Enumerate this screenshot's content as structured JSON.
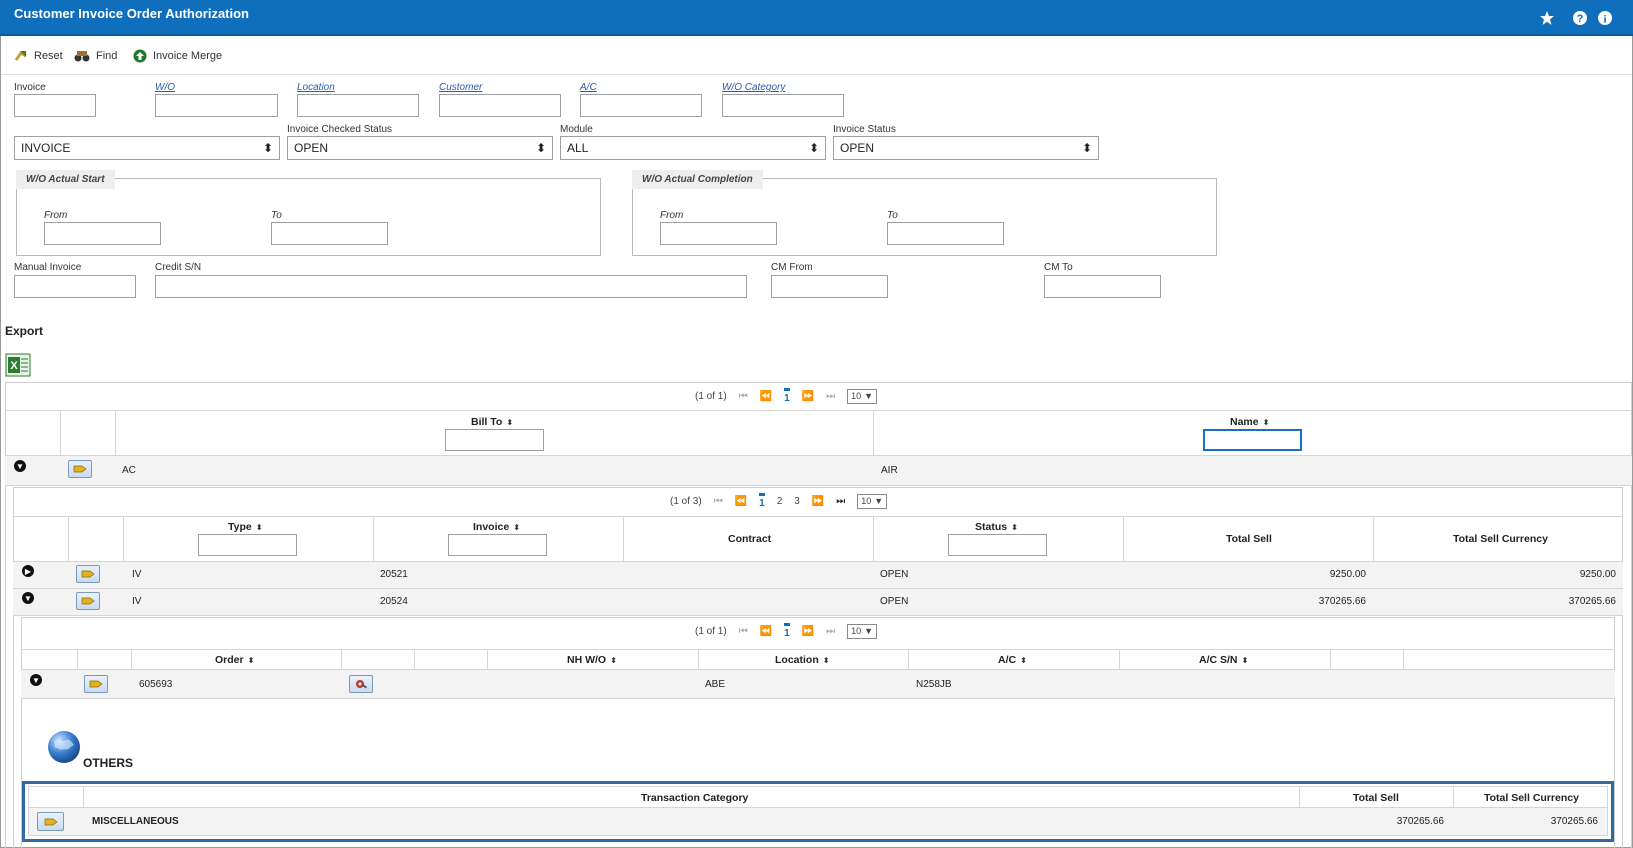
{
  "app": {
    "title": "Customer Invoice Order Authorization"
  },
  "toolbar": {
    "reset": "Reset",
    "find": "Find",
    "invoice_merge": "Invoice Merge"
  },
  "filters": {
    "invoice_label": "Invoice",
    "wo_label": "W/O",
    "location_label": "Location",
    "customer_label": "Customer",
    "ac_label": "A/C",
    "wo_category_label": "W/O Category",
    "type_value": "INVOICE",
    "invoice_checked_status_label": "Invoice Checked Status",
    "invoice_checked_status_value": "OPEN",
    "module_label": "Module",
    "module_value": "ALL",
    "invoice_status_label": "Invoice Status",
    "invoice_status_value": "OPEN",
    "wo_actual_start_legend": "W/O Actual Start",
    "wo_actual_completion_legend": "W/O Actual Completion",
    "from_label": "From",
    "to_label": "To",
    "manual_invoice_label": "Manual Invoice",
    "credit_sn_label": "Credit S/N",
    "cm_from_label": "CM From",
    "cm_to_label": "CM To"
  },
  "export": {
    "label": "Export"
  },
  "pager1": {
    "info": "(1 of 1)",
    "page": "1",
    "rows": "10"
  },
  "grid1": {
    "headers": {
      "bill_to": "Bill To",
      "name": "Name"
    },
    "row": {
      "bill_to": "AC",
      "name": "AIR"
    }
  },
  "pager2": {
    "info": "(1 of 3)",
    "page1": "1",
    "page2": "2",
    "page3": "3",
    "rows": "10"
  },
  "grid2": {
    "headers": {
      "type": "Type",
      "invoice": "Invoice",
      "contract": "Contract",
      "status": "Status",
      "total_sell": "Total Sell",
      "total_sell_currency": "Total Sell Currency"
    },
    "rows": [
      {
        "type": "IV",
        "invoice": "20521",
        "contract": "",
        "status": "OPEN",
        "total_sell": "9250.00",
        "total_sell_currency": "9250.00"
      },
      {
        "type": "IV",
        "invoice": "20524",
        "contract": "",
        "status": "OPEN",
        "total_sell": "370265.66",
        "total_sell_currency": "370265.66"
      }
    ]
  },
  "pager3": {
    "info": "(1 of 1)",
    "page": "1",
    "rows": "10"
  },
  "grid3": {
    "headers": {
      "order": "Order",
      "nh_wo": "NH W/O",
      "location": "Location",
      "ac": "A/C",
      "ac_sn": "A/C S/N"
    },
    "row": {
      "order": "605693",
      "nh_wo": "",
      "location": "ABE",
      "ac": "N258JB",
      "ac_sn": ""
    }
  },
  "others": {
    "label": "OTHERS"
  },
  "grid4": {
    "headers": {
      "transaction_category": "Transaction Category",
      "total_sell": "Total Sell",
      "total_sell_currency": "Total Sell Currency"
    },
    "row": {
      "transaction_category": "MISCELLANEOUS",
      "total_sell": "370265.66",
      "total_sell_currency": "370265.66"
    }
  },
  "colors": {
    "titlebar": "#0f6fbd",
    "highlight_border": "#2f6aa0"
  }
}
